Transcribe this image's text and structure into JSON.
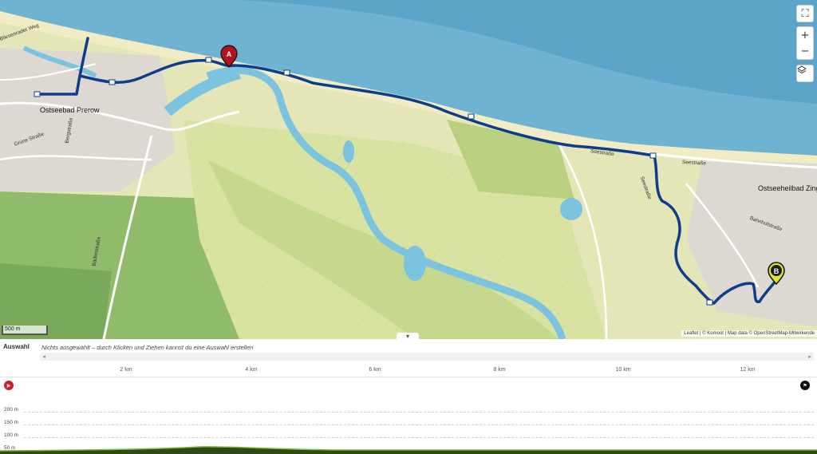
{
  "map": {
    "places": {
      "prerow": "Ostseebad Prerow",
      "zingst": "Ostseeheilbad Zing"
    },
    "streets": {
      "gruene_strasse": "Grüne Straße",
      "bergstrasse": "Bergstraße",
      "bliesenrader_weg": "Bliesenrader Weg",
      "badenstrasse": "Bädenstraße",
      "seestrasse_1": "Seestraße",
      "seestrasse_2": "Seestraße",
      "seestrasse_3": "Seestraße",
      "bahnhofstrasse": "Bahnhofstraße"
    },
    "markers": {
      "a": "A",
      "b": "B"
    },
    "scale": "500 m",
    "attribution": "Leaflet | © Komoot | Map data © OpenStreetMap-Mitwirkende",
    "controls": {
      "fullscreen_icon": "fullscreen-icon",
      "zoom_in": "+",
      "zoom_out": "−",
      "layers_icon": "layers-icon"
    },
    "colors": {
      "sea": "#6fb3d2",
      "route": "#0d3e8c",
      "marker_a": "#b4121d",
      "marker_b": "#1d1d1d"
    }
  },
  "panel": {
    "collapse": "▾",
    "selection_title": "Auswahl",
    "selection_hint": "Nichts ausgewählt – durch Klicken und Ziehen kannst du eine Auswahl erstellen",
    "scroll_left": "◂",
    "scroll_right": "▸",
    "km_ticks": [
      "2 km",
      "4 km",
      "6 km",
      "8 km",
      "10 km",
      "12 km"
    ],
    "elevation_labels": [
      "200 m",
      "150 m",
      "100 m",
      "50 m"
    ],
    "start_icon": "start-flag-icon",
    "finish_icon": "finish-flag-icon"
  }
}
